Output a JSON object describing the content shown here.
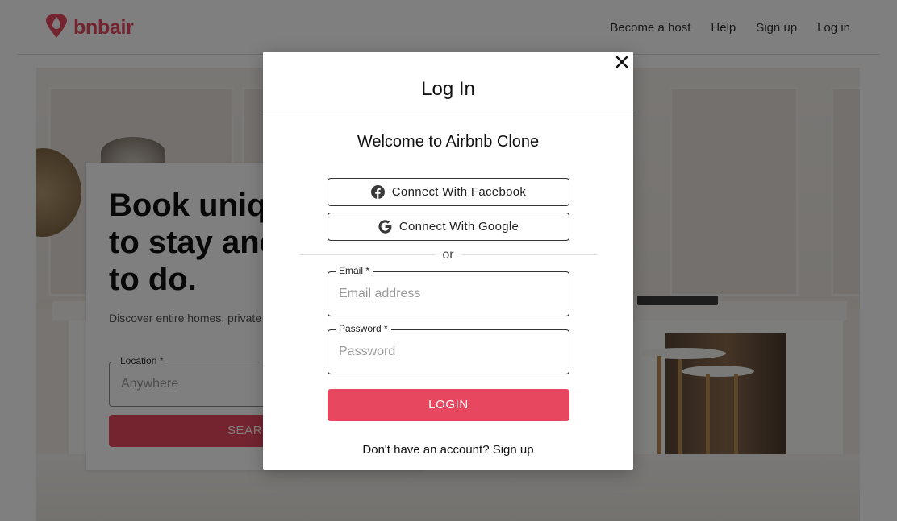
{
  "header": {
    "brand": "bnbair",
    "logo_icon": "airbnb-logo-icon",
    "brand_color": "#e8485f",
    "nav": [
      {
        "label": "Become a host"
      },
      {
        "label": "Help"
      },
      {
        "label": "Sign up"
      },
      {
        "label": "Log in"
      }
    ]
  },
  "hero": {
    "title": "Book unique places to stay and things to do.",
    "description": "Discover entire homes, private rooms perfect for any trip.",
    "location_label": "Location *",
    "location_placeholder": "Anywhere",
    "search_label": "SEARCH"
  },
  "modal": {
    "title": "Log In",
    "close_icon": "close-icon",
    "welcome": "Welcome to Airbnb Clone",
    "facebook_label": "Connect With Facebook",
    "google_label": "Connect With Google",
    "divider": "or",
    "email_label": "Email *",
    "email_placeholder": "Email address",
    "password_label": "Password *",
    "password_placeholder": "Password",
    "login_label": "LOGIN",
    "signup_prompt": "Don't have an account?",
    "signup_link": "Sign up"
  },
  "colors": {
    "accent": "#e8485f",
    "backdrop": "rgba(0,0,0,0.5)"
  }
}
